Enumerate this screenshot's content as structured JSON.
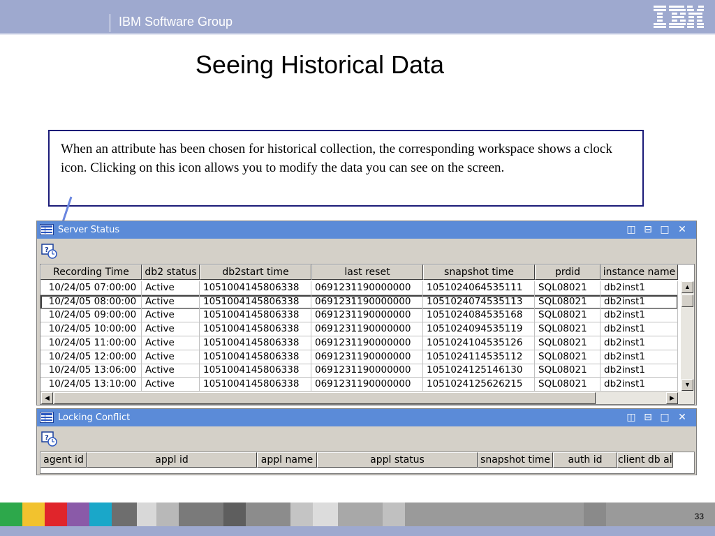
{
  "header": {
    "group": "IBM Software Group",
    "logo": "IBM"
  },
  "slide": {
    "title": "Seeing Historical Data",
    "callout": "When an attribute has been chosen for historical collection, the corresponding workspace shows a clock icon. Clicking on this icon allows you to modify the data you can see on the screen.",
    "page_number": "33"
  },
  "server_status": {
    "title": "Server Status",
    "columns": [
      "Recording Time",
      "db2 status",
      "db2start time",
      "last reset",
      "snapshot time",
      "prdid",
      "instance name"
    ],
    "rows": [
      [
        "10/24/05 07:00:00",
        "Active",
        "1051004145806338",
        "0691231190000000",
        "1051024064535111",
        "SQL08021",
        "db2inst1"
      ],
      [
        "10/24/05 08:00:00",
        "Active",
        "1051004145806338",
        "0691231190000000",
        "1051024074535113",
        "SQL08021",
        "db2inst1"
      ],
      [
        "10/24/05 09:00:00",
        "Active",
        "1051004145806338",
        "0691231190000000",
        "1051024084535168",
        "SQL08021",
        "db2inst1"
      ],
      [
        "10/24/05 10:00:00",
        "Active",
        "1051004145806338",
        "0691231190000000",
        "1051024094535119",
        "SQL08021",
        "db2inst1"
      ],
      [
        "10/24/05 11:00:00",
        "Active",
        "1051004145806338",
        "0691231190000000",
        "1051024104535126",
        "SQL08021",
        "db2inst1"
      ],
      [
        "10/24/05 12:00:00",
        "Active",
        "1051004145806338",
        "0691231190000000",
        "1051024114535112",
        "SQL08021",
        "db2inst1"
      ],
      [
        "10/24/05 13:06:00",
        "Active",
        "1051004145806338",
        "0691231190000000",
        "1051024125146130",
        "SQL08021",
        "db2inst1"
      ],
      [
        "10/24/05 13:10:00",
        "Active",
        "1051004145806338",
        "0691231190000000",
        "1051024125626215",
        "SQL08021",
        "db2inst1"
      ]
    ],
    "selected_row": 1
  },
  "locking_conflict": {
    "title": "Locking Conflict",
    "columns": [
      "agent id",
      "appl id",
      "appl name",
      "appl status",
      "snapshot time",
      "auth id",
      "client db ali:"
    ]
  },
  "colors": {
    "header_bar": "#9ea9cf",
    "title_bar": "#5b8bd8",
    "callout_border": "#1b1b78",
    "arrow": "#6a86e0"
  },
  "icons": [
    "table-icon",
    "history-clock-icon",
    "split-vertical-icon",
    "split-horizontal-icon",
    "maximize-icon",
    "close-icon"
  ]
}
